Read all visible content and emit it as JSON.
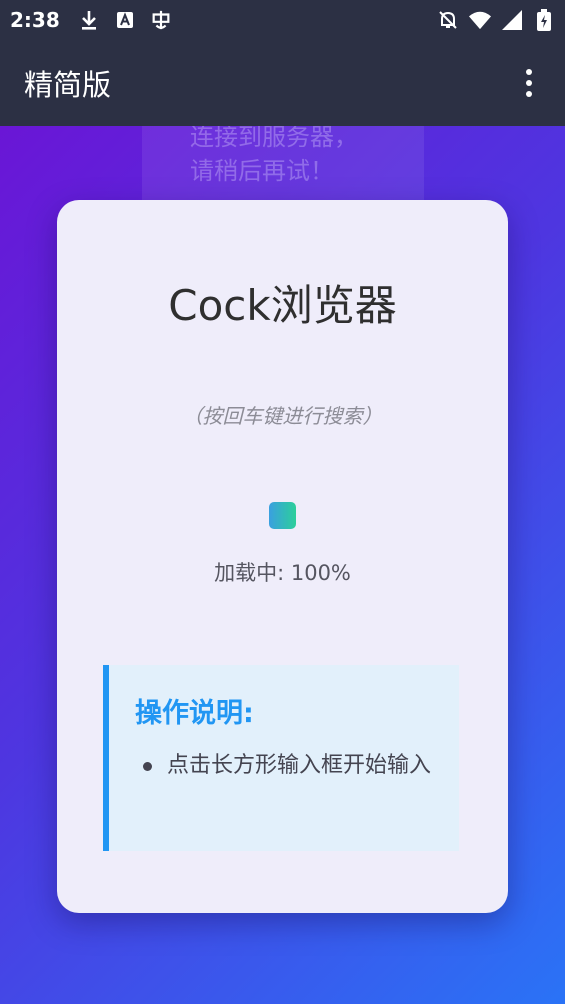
{
  "status_bar": {
    "time": "2:38",
    "left_icons": [
      "download-icon",
      "font-icon",
      "bug-icon"
    ],
    "right_icons": [
      "bell-off-icon",
      "wifi-icon",
      "signal-icon",
      "battery-icon"
    ]
  },
  "app_bar": {
    "title": "精简版",
    "menu_icon": "more-vert-icon"
  },
  "toast": {
    "lines": [
      "连接到服务器，",
      "请稍后再试！"
    ]
  },
  "card": {
    "title": "Cock浏览器",
    "search_hint": "（按回车键进行搜索）",
    "loading_text": "加载中: 100%",
    "instructions": {
      "title": "操作说明:",
      "items": [
        "点击长方形输入框开始输入"
      ]
    }
  },
  "colors": {
    "bar_bg": "#2c3044",
    "accent_blue": "#2196f3",
    "gradient_start": "#6a16d6",
    "gradient_end": "#2a73f6"
  }
}
